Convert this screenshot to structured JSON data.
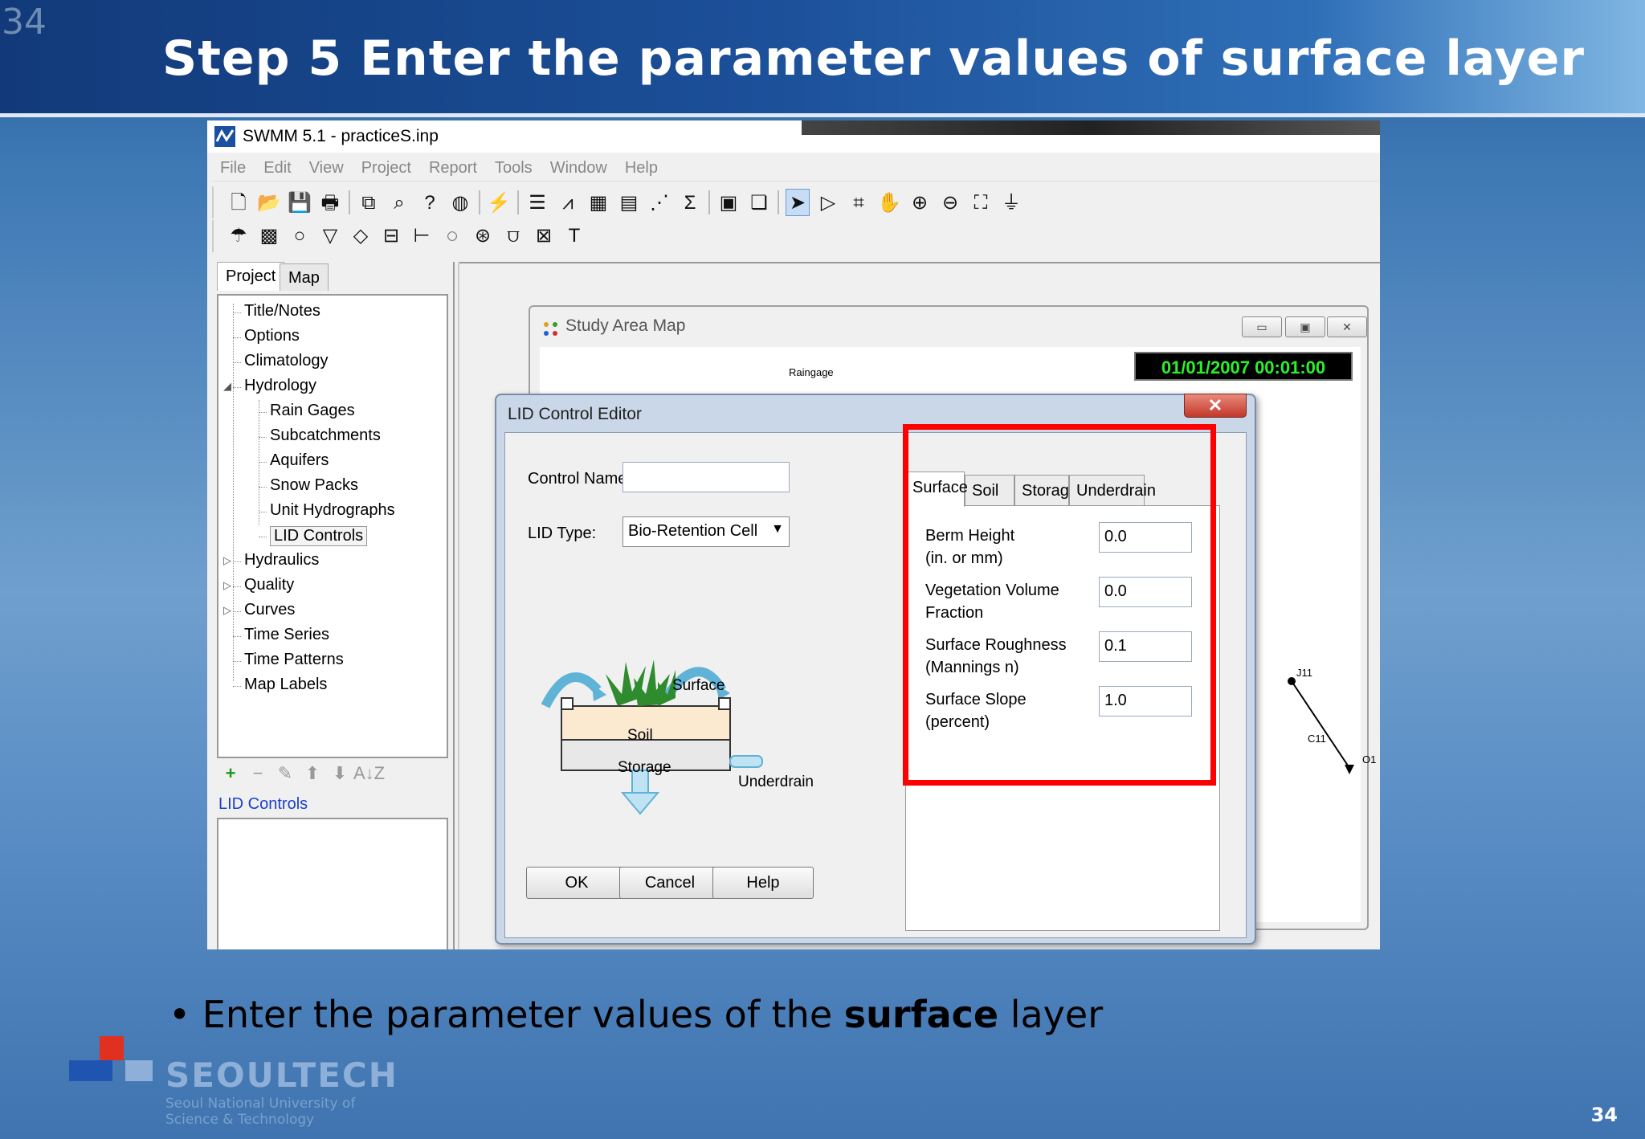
{
  "slide": {
    "corner_number": "34",
    "title": "Step 5 Enter the parameter values of surface layer",
    "bullet_prefix": "Enter the parameter values of the ",
    "bullet_bold": "surface",
    "bullet_suffix": " layer",
    "logo_text": "SEOULTECH",
    "logo_sub_line1": "Seoul National University of",
    "logo_sub_line2": "Science & Technology",
    "page_number": "34"
  },
  "app": {
    "title": "SWMM 5.1 - practiceS.inp",
    "menu": [
      "File",
      "Edit",
      "View",
      "Project",
      "Report",
      "Tools",
      "Window",
      "Help"
    ],
    "toolbar1_icons": [
      "new-icon",
      "open-icon",
      "save-icon",
      "print-icon",
      "copy-icon",
      "find-icon",
      "query-icon",
      "globe-icon",
      "run-icon",
      "report-icon",
      "profile-icon",
      "graph-icon",
      "table-icon",
      "scatter-icon",
      "sigma-icon",
      "options-icon",
      "layers-icon",
      "select-icon",
      "vertex-icon",
      "region-icon",
      "pan-icon",
      "zoom-in-icon",
      "zoom-out-icon",
      "full-extent-icon",
      "measure-icon"
    ],
    "toolbar2_icons": [
      "raingage-icon",
      "subcatchment-icon",
      "junction-icon",
      "outfall-icon",
      "divider-icon",
      "storage-icon",
      "conduit-icon",
      "pump-icon",
      "orifice-icon",
      "weir-icon",
      "outlet-icon",
      "label-icon"
    ]
  },
  "left_panel": {
    "tabs": [
      "Project",
      "Map"
    ],
    "active_tab": "Project",
    "tree": [
      {
        "label": "Title/Notes",
        "level": 0,
        "twisty": ""
      },
      {
        "label": "Options",
        "level": 0,
        "twisty": ""
      },
      {
        "label": "Climatology",
        "level": 0,
        "twisty": ""
      },
      {
        "label": "Hydrology",
        "level": 0,
        "twisty": "◢"
      },
      {
        "label": "Rain Gages",
        "level": 1,
        "twisty": ""
      },
      {
        "label": "Subcatchments",
        "level": 1,
        "twisty": ""
      },
      {
        "label": "Aquifers",
        "level": 1,
        "twisty": ""
      },
      {
        "label": "Snow Packs",
        "level": 1,
        "twisty": ""
      },
      {
        "label": "Unit Hydrographs",
        "level": 1,
        "twisty": ""
      },
      {
        "label": "LID Controls",
        "level": 1,
        "twisty": "",
        "selected": true
      },
      {
        "label": "Hydraulics",
        "level": 0,
        "twisty": "▷"
      },
      {
        "label": "Quality",
        "level": 0,
        "twisty": "▷"
      },
      {
        "label": "Curves",
        "level": 0,
        "twisty": "▷"
      },
      {
        "label": "Time Series",
        "level": 0,
        "twisty": ""
      },
      {
        "label": "Time Patterns",
        "level": 0,
        "twisty": ""
      },
      {
        "label": "Map Labels",
        "level": 0,
        "twisty": ""
      }
    ],
    "list_tools": [
      "+",
      "−",
      "✎",
      "⬆",
      "⬇",
      "A↓Z"
    ],
    "list_label": "LID Controls"
  },
  "map_window": {
    "title": "Study Area Map",
    "clock": "01/01/2007 00:01:00",
    "labels": {
      "raingage": "Raingage",
      "j11": "J11",
      "c11": "C11",
      "o1": "O1"
    }
  },
  "lid_editor": {
    "title": "LID Control Editor",
    "close": "✕",
    "control_name_label": "Control Name:",
    "control_name_value": "",
    "lid_type_label": "LID Type:",
    "lid_type_value": "Bio-Retention Cell",
    "diagram": {
      "surface": "Surface",
      "soil": "Soil",
      "storage": "Storage",
      "underdrain": "Underdrain"
    },
    "buttons": {
      "ok": "OK",
      "cancel": "Cancel",
      "help": "Help"
    },
    "tabs": [
      "Surface",
      "Soil",
      "Storage",
      "Underdrain"
    ],
    "active_tab": "Surface",
    "params": [
      {
        "line1": "Berm Height",
        "line2": "(in. or mm)",
        "value": "0.0"
      },
      {
        "line1": "Vegetation Volume",
        "line2": "Fraction",
        "value": "0.0"
      },
      {
        "line1": "Surface Roughness",
        "line2": "(Mannings n)",
        "value": "0.1"
      },
      {
        "line1": "Surface Slope",
        "line2": "(percent)",
        "value": "1.0"
      }
    ]
  },
  "colors": {
    "highlight": "#ff0000",
    "clock_text": "#2cf02c",
    "list_label": "#1a3fcf"
  }
}
